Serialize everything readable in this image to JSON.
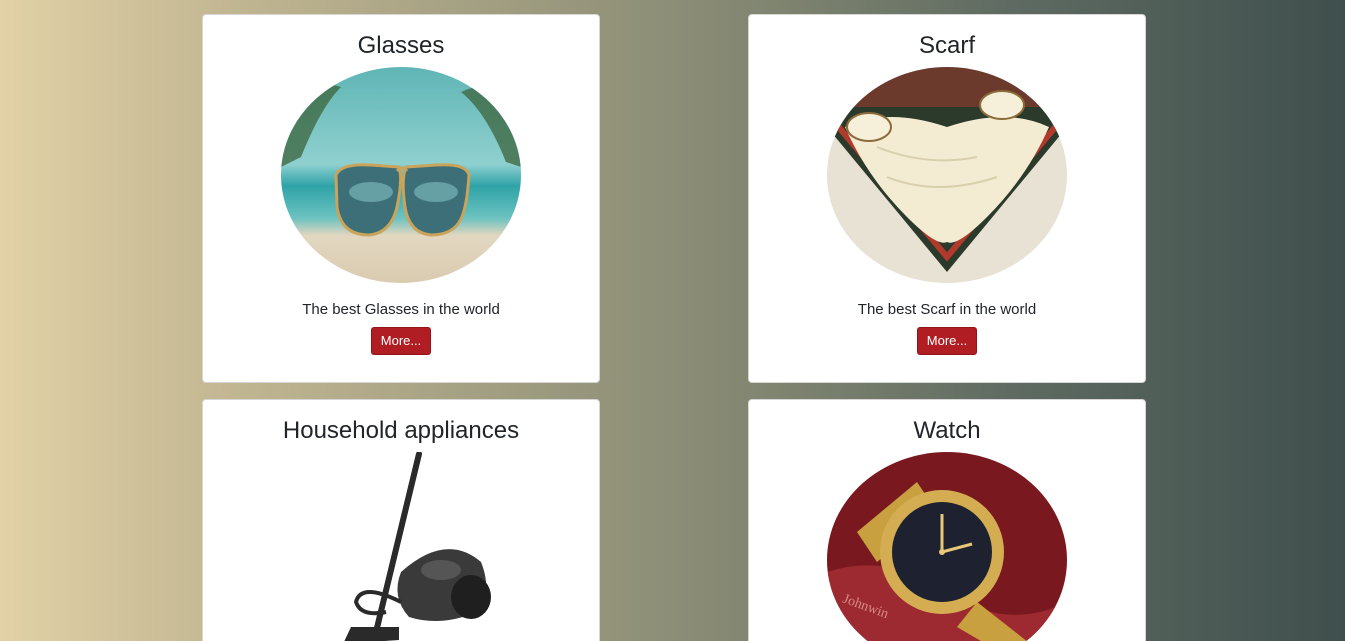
{
  "cards": [
    {
      "title": "Glasses",
      "image_alt": "sunglasses-on-beach",
      "text": "The best Glasses in the world",
      "button_label": "More..."
    },
    {
      "title": "Scarf",
      "image_alt": "folded-scarf",
      "text": "The best Scarf in the world",
      "button_label": "More..."
    },
    {
      "title": "Household appliances",
      "image_alt": "vacuum-cleaner"
    },
    {
      "title": "Watch",
      "image_alt": "gold-wristwatch"
    }
  ],
  "colors": {
    "button_bg": "#b01e23",
    "gradient_left": "#e2d1a6",
    "gradient_right": "#3f4f4d"
  }
}
